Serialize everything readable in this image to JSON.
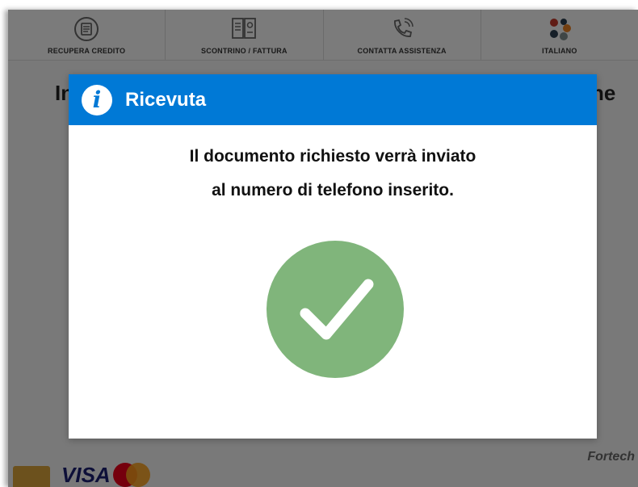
{
  "topbar": {
    "items": [
      {
        "label": "RECUPERA CREDITO",
        "icon": "credit-recovery-icon"
      },
      {
        "label": "SCONTRINO / FATTURA",
        "icon": "receipt-icon"
      },
      {
        "label": "CONTATTA ASSISTENZA",
        "icon": "phone-support-icon"
      },
      {
        "label": "ITALIANO",
        "icon": "language-flags-icon"
      }
    ]
  },
  "background": {
    "heading_left": "In",
    "heading_right": "ne"
  },
  "footer": {
    "visa": "VISA",
    "brand": "Fortech"
  },
  "dialog": {
    "title": "Ricevuta",
    "message_line1": "Il documento richiesto verrà inviato",
    "message_line2": "al numero di telefono inserito.",
    "info_glyph": "i",
    "colors": {
      "header": "#0079d6",
      "success": "#80b57b"
    }
  }
}
